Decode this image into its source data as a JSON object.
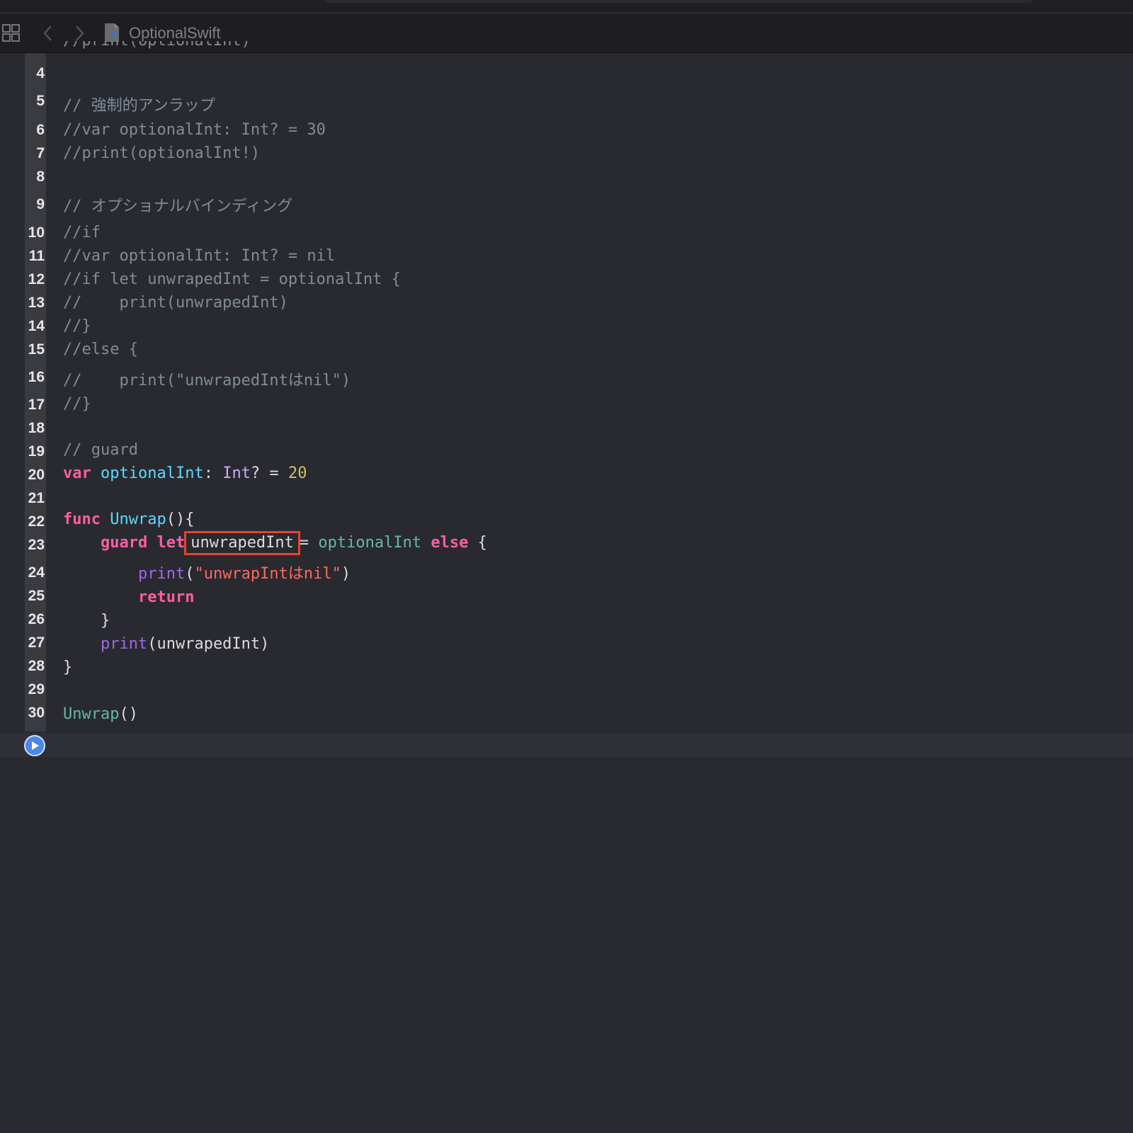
{
  "window": {
    "file_name": "OptionalSwift"
  },
  "toolbar": {
    "grid_icon": "related-items-grid-icon",
    "back_icon": "chevron-left-icon",
    "forward_icon": "chevron-right-icon",
    "file_icon": "swift-file-icon"
  },
  "editor": {
    "partial_top_line": "//print(optionalInt)",
    "line_numbers": [
      "4",
      "5",
      "6",
      "7",
      "8",
      "9",
      "10",
      "11",
      "12",
      "13",
      "14",
      "15",
      "16",
      "17",
      "18",
      "19",
      "20",
      "21",
      "22",
      "23",
      "24",
      "25",
      "26",
      "27",
      "28",
      "29",
      "30"
    ],
    "comments": {
      "l5": "// 強制的アンラップ",
      "l6": "//var optionalInt: Int? = 30",
      "l7": "//print(optionalInt!)",
      "l9": "// オプショナルバインディング",
      "l10": "//if",
      "l11": "//var optionalInt: Int? = nil",
      "l12": "//if let unwrapedInt = optionalInt {",
      "l13": "//    print(unwrapedInt)",
      "l14": "//}",
      "l15": "//else {",
      "l16": "//    print(\"unwrapedIntはnil\")",
      "l17": "//}",
      "l19": "// guard"
    },
    "tokens": {
      "var": "var",
      "optionalInt": "optionalInt",
      "colon": ":",
      "Int": "Int",
      "q_eq": "? =",
      "twenty": "20",
      "func": "func",
      "Unwrap": "Unwrap",
      "parens_brace": "(){",
      "guard": "guard",
      "let": "let",
      "unwrapedInt": "unwrapedInt",
      "eq": "=",
      "else": "else",
      "open_brace": "{",
      "print": "print",
      "paren_open": "(",
      "str_nil": "\"unwrapIntはnil\"",
      "paren_close": ")",
      "return": "return",
      "close_brace": "}",
      "call_parens": "()"
    },
    "highlight_color": "#e5432d",
    "run_button_icon": "play-icon"
  }
}
